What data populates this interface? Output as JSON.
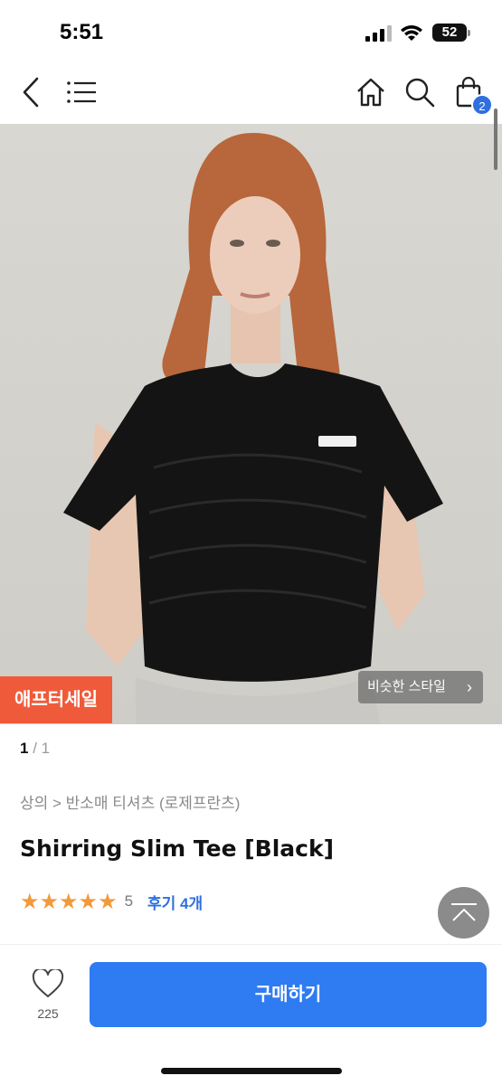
{
  "status_bar": {
    "time": "5:51",
    "battery": "52"
  },
  "nav": {
    "back_icon": "chevron-left-icon",
    "menu_icon": "hamburger-menu-icon",
    "home_icon": "home-icon",
    "search_icon": "search-icon",
    "cart_icon": "shopping-bag-icon",
    "cart_count": "2"
  },
  "product": {
    "image_description_icon": "product-photo",
    "sale_badge": "애프터세일",
    "similar_style": "비슷한 스타일",
    "page_current": "1",
    "page_total": "/ 1",
    "breadcrumb": "상의 > 반소매 티셔츠 (로제프란츠)",
    "title": "Shirring Slim Tee [Black]",
    "stars": "★★★★★",
    "rating": "5",
    "reviews": "후기 4개"
  },
  "bottom_bar": {
    "like_count": "225",
    "buy_label": "구매하기"
  },
  "colors": {
    "accent": "#2f7bf2",
    "sale": "#ef5b3a",
    "star": "#f29a3b",
    "badge": "#2f6fe0"
  }
}
